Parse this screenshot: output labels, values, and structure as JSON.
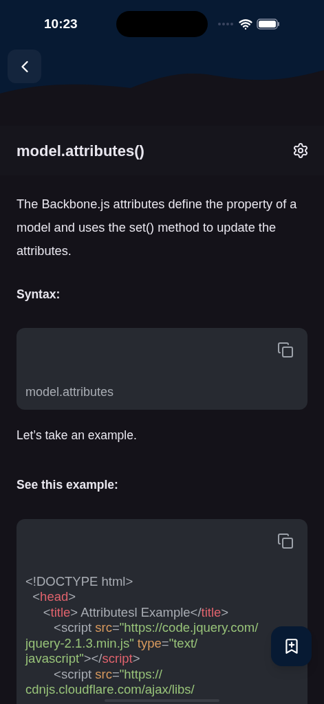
{
  "status_bar": {
    "time": "10:23"
  },
  "title": "model.attributes()",
  "intro": "The Backbone.js attributes define the property of a model and uses the set() method to update the attributes.",
  "syntax_heading": "Syntax:",
  "syntax_code": "model.attributes",
  "lead": "Let’s take an example.",
  "example_heading": "See this example:",
  "example_code": [
    [
      {
        "kind": "plain",
        "text": "<!DOCTYPE html>"
      }
    ],
    [
      {
        "kind": "plain",
        "text": "  <"
      },
      {
        "kind": "tag",
        "text": "head"
      },
      {
        "kind": "plain",
        "text": ">"
      }
    ],
    [
      {
        "kind": "plain",
        "text": "     <"
      },
      {
        "kind": "tag",
        "text": "title"
      },
      {
        "kind": "plain",
        "text": "> Attributesl Example</"
      },
      {
        "kind": "tag",
        "text": "title"
      },
      {
        "kind": "plain",
        "text": ">"
      }
    ],
    [
      {
        "kind": "plain",
        "text": "        <script "
      },
      {
        "kind": "attr",
        "text": "src"
      },
      {
        "kind": "plain",
        "text": "="
      },
      {
        "kind": "string",
        "text": "\"https://code.jquery.com/"
      }
    ],
    [
      {
        "kind": "string",
        "text": "jquery-2.1.3.min.js\" "
      },
      {
        "kind": "attr",
        "text": "type"
      },
      {
        "kind": "plain",
        "text": "="
      },
      {
        "kind": "string",
        "text": "\"text/"
      }
    ],
    [
      {
        "kind": "string",
        "text": "javascript\""
      },
      {
        "kind": "plain",
        "text": "></"
      },
      {
        "kind": "tag",
        "text": "script"
      },
      {
        "kind": "plain",
        "text": ">"
      }
    ],
    [
      {
        "kind": "plain",
        "text": "        <script "
      },
      {
        "kind": "attr",
        "text": "src"
      },
      {
        "kind": "plain",
        "text": "="
      },
      {
        "kind": "string",
        "text": "\"https://"
      }
    ],
    [
      {
        "kind": "string",
        "text": "cdnjs.cloudflare.com/ajax/libs/"
      }
    ]
  ]
}
